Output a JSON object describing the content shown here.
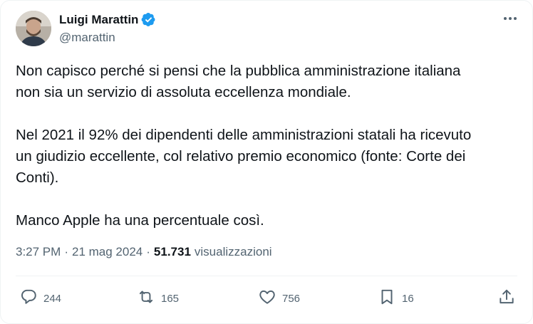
{
  "author": {
    "name": "Luigi Marattin",
    "handle": "@marattin"
  },
  "tweet": {
    "p1_line1": "Non capisco perché si pensi che la pubblica amministrazione italiana",
    "p1_line2": "non sia un servizio di assoluta eccellenza mondiale.",
    "p2_line1": "Nel 2021 il 92% dei dipendenti delle amministrazioni statali ha ricevuto",
    "p2_line2": "un giudizio eccellente, col relativo premio economico (fonte: Corte dei",
    "p2_line3": "Conti).",
    "p3_line1": "Manco Apple ha una percentuale così."
  },
  "meta": {
    "time": "3:27 PM",
    "sep": "·",
    "date": "21 mag 2024",
    "views_count": "51.731",
    "views_label": "visualizzazioni"
  },
  "actions": {
    "replies": "244",
    "reposts": "165",
    "likes": "756",
    "bookmarks": "16"
  },
  "colors": {
    "verified": "#1d9bf0",
    "secondary_text": "#536471",
    "primary_text": "#0f1419"
  }
}
